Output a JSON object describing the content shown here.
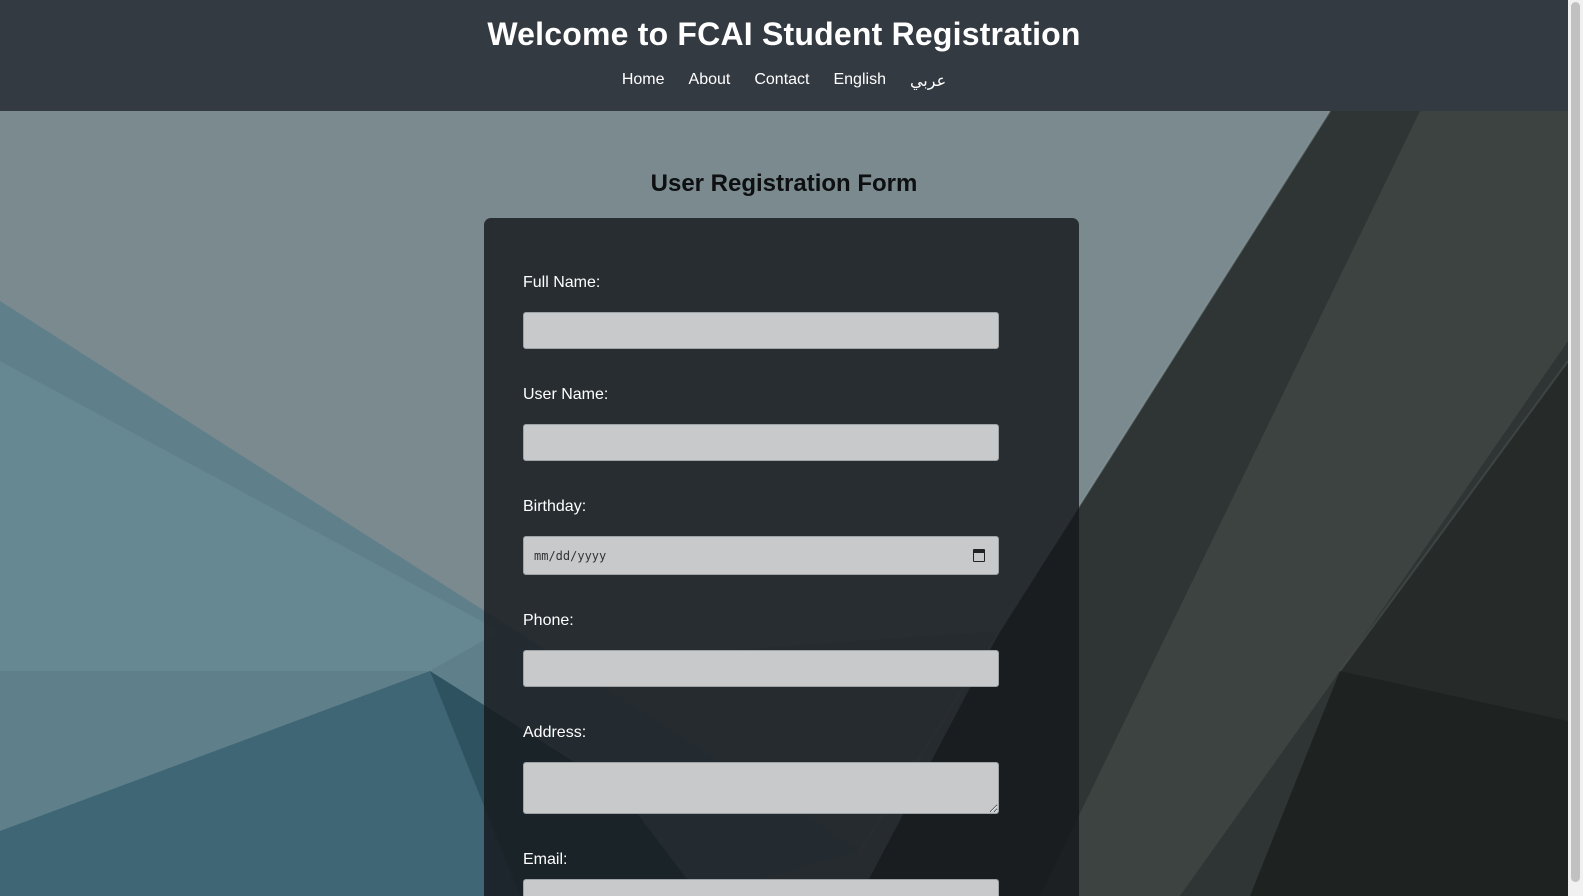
{
  "header": {
    "title": "Welcome to FCAI Student Registration",
    "nav": [
      "Home",
      "About",
      "Contact",
      "English",
      "عربي"
    ]
  },
  "form": {
    "title": "User Registration Form",
    "fields": {
      "full_name": {
        "label": "Full Name:",
        "value": ""
      },
      "user_name": {
        "label": "User Name:",
        "value": ""
      },
      "birthday": {
        "label": "Birthday:",
        "placeholder": "mm/dd/yyyy"
      },
      "phone": {
        "label": "Phone:",
        "value": ""
      },
      "address": {
        "label": "Address:",
        "value": ""
      },
      "email": {
        "label": "Email:",
        "value": ""
      }
    }
  },
  "icons": {
    "birthday_picker": "calendar-icon"
  },
  "colors": {
    "header_bg": "#343a42",
    "card_bg": "#16191c",
    "input_bg": "#c7c9cb",
    "title_text": "#0d0f11"
  }
}
